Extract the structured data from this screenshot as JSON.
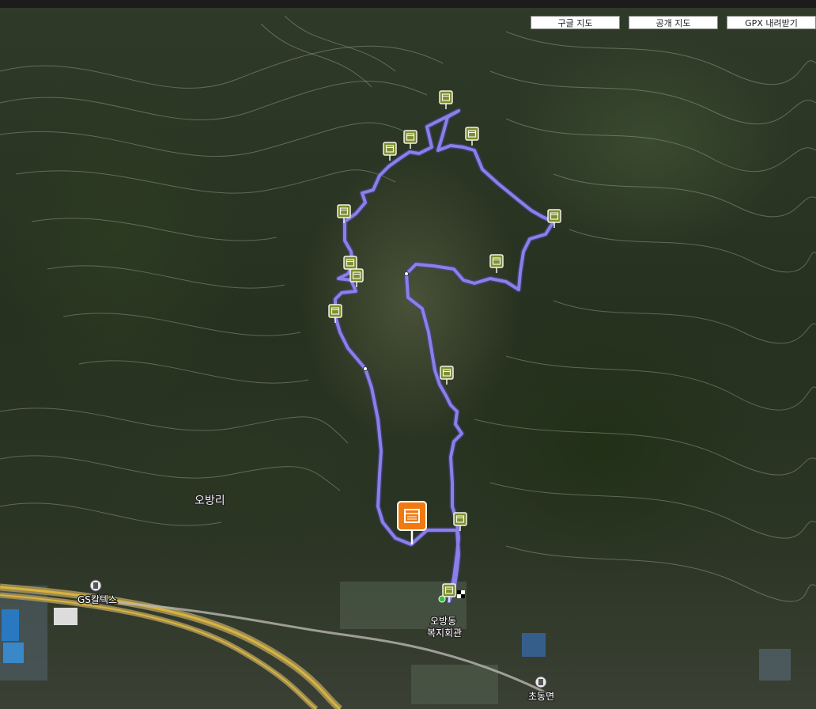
{
  "map_buttons": {
    "google": "구글 지도",
    "public": "공개 지도",
    "gpx": "GPX 내려받기"
  },
  "place_labels": {
    "obangri": "오방리",
    "gs": "GS칼텍스",
    "welfare_line1": "오방동",
    "welfare_line2": "복지회관",
    "chodong": "초동면"
  },
  "colors": {
    "track": "#8a80e8",
    "waypoint_marker": "#7d8f2e",
    "start_marker": "#f07a10",
    "highway": "#d9b43a"
  },
  "icons": {
    "waypoint": "calendar-pin-icon",
    "start": "calendar-pin-icon",
    "finish": "checkered-flag-icon"
  }
}
